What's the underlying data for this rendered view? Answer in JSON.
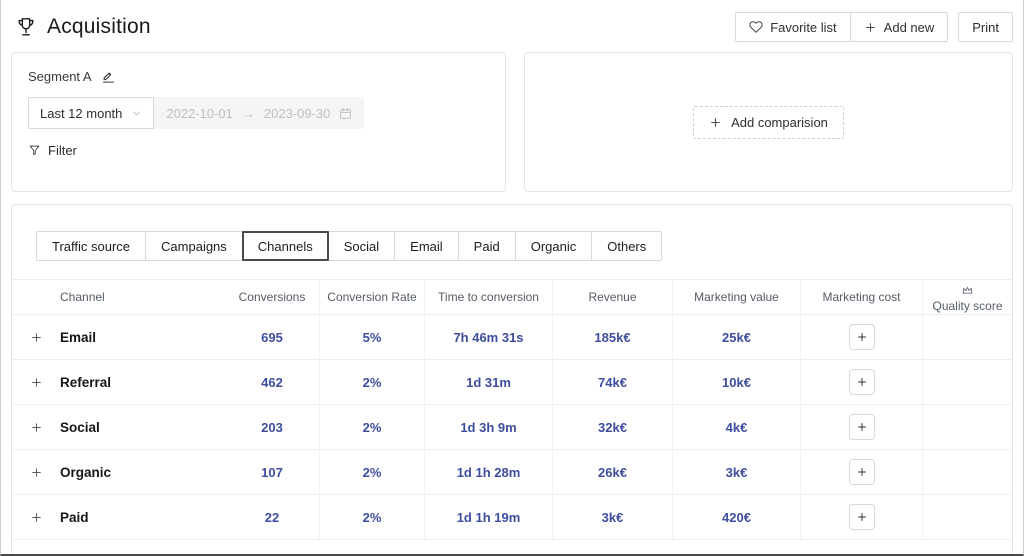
{
  "colors": {
    "accent": "#3d4e9e"
  },
  "header": {
    "title": "Acquisition",
    "favorite_button": "Favorite list",
    "add_new_button": "Add new",
    "print_button": "Print"
  },
  "filters": {
    "segment_name": "Segment A",
    "period": "Last 12 month",
    "date_start": "2022-10-01",
    "date_arrow": "→",
    "date_end": "2023-09-30",
    "filter_label": "Filter"
  },
  "comparison": {
    "add_button": "Add comparision"
  },
  "tabs": [
    {
      "label": "Traffic source",
      "active": false
    },
    {
      "label": "Campaigns",
      "active": false
    },
    {
      "label": "Channels",
      "active": true
    },
    {
      "label": "Social",
      "active": false
    },
    {
      "label": "Email",
      "active": false
    },
    {
      "label": "Paid",
      "active": false
    },
    {
      "label": "Organic",
      "active": false
    },
    {
      "label": "Others",
      "active": false
    }
  ],
  "table": {
    "headers": {
      "channel": "Channel",
      "conversions": "Conversions",
      "rate": "Conversion Rate",
      "time": "Time to conversion",
      "revenue": "Revenue",
      "value": "Marketing value",
      "cost": "Marketing cost",
      "quality": "Quality score"
    },
    "rows": [
      {
        "channel": "Email",
        "conversions": "695",
        "rate": "5%",
        "time": "7h 46m 31s",
        "revenue": "185k€",
        "value": "25k€"
      },
      {
        "channel": "Referral",
        "conversions": "462",
        "rate": "2%",
        "time": "1d 31m",
        "revenue": "74k€",
        "value": "10k€"
      },
      {
        "channel": "Social",
        "conversions": "203",
        "rate": "2%",
        "time": "1d 3h 9m",
        "revenue": "32k€",
        "value": "4k€"
      },
      {
        "channel": "Organic",
        "conversions": "107",
        "rate": "2%",
        "time": "1d 1h 28m",
        "revenue": "26k€",
        "value": "3k€"
      },
      {
        "channel": "Paid",
        "conversions": "22",
        "rate": "2%",
        "time": "1d 1h 19m",
        "revenue": "3k€",
        "value": "420€"
      }
    ]
  }
}
